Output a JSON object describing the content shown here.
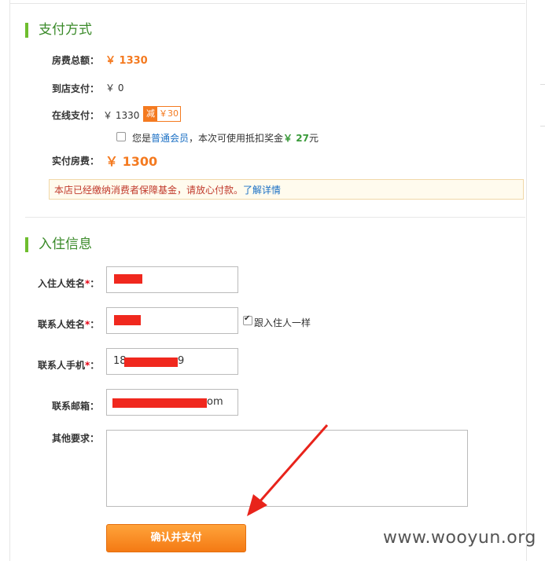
{
  "payment": {
    "title": "支付方式",
    "total_label": "房费总额：",
    "total_value": "￥ 1330",
    "store_label": "到店支付：",
    "store_value": "￥ 0",
    "online_label": "在线支付：",
    "online_value": "￥ 1330",
    "discount_tag": "减",
    "discount_value": "￥30",
    "member_prefix": "您是",
    "member_link": "普通会员",
    "member_mid": "，本次可使用抵扣奖金",
    "member_amount": "￥ 27",
    "member_suffix": "元",
    "actual_label": "实付房费：",
    "actual_value": "￥ 1300",
    "notice_text": "本店已经缴纳消费者保障基金，请放心付款。",
    "notice_link": "了解详情"
  },
  "checkin": {
    "title": "入住信息",
    "guest_label": "入住人姓名",
    "contact_label": "联系人姓名",
    "contact_same_label": "跟入住人一样",
    "phone_label": "联系人手机",
    "phone_value_start": "18",
    "phone_value_end": "9",
    "email_label": "联系邮箱：",
    "email_value_end": "om",
    "other_label": "其他要求：",
    "required_mark": "*",
    "colon": "："
  },
  "actions": {
    "confirm_pay_label": "确认并支付"
  },
  "watermark": "www.wooyun.org",
  "colors": {
    "accent": "#f47a20",
    "section_green": "#6ebd2e",
    "redaction": "#f0281e",
    "link": "#1a6fc4"
  }
}
